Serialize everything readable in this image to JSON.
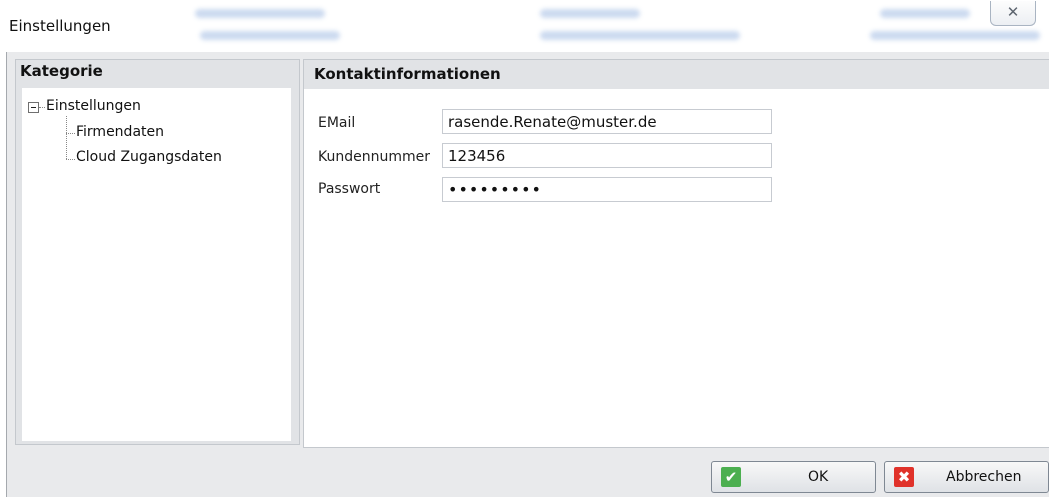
{
  "window": {
    "title": "Einstellungen",
    "close_glyph": "✕"
  },
  "category_panel": {
    "header": "Kategorie",
    "tree": {
      "root_label": "Einstellungen",
      "children": [
        "Firmendaten",
        "Cloud Zugangsdaten"
      ]
    }
  },
  "contact_panel": {
    "header": "Kontaktinformationen",
    "fields": {
      "email": {
        "label": "EMail",
        "value": "rasende.Renate@muster.de"
      },
      "customer_number": {
        "label": "Kundennummer",
        "value": "123456"
      },
      "password": {
        "label": "Passwort",
        "value": "•••••••••"
      }
    }
  },
  "buttons": {
    "ok": {
      "label": "OK",
      "icon": "checkmark-icon",
      "icon_glyph": "✔",
      "color": "#4caf50"
    },
    "cancel": {
      "label": "Abbrechen",
      "icon": "cross-icon",
      "icon_glyph": "✖",
      "color": "#e0322a"
    }
  }
}
